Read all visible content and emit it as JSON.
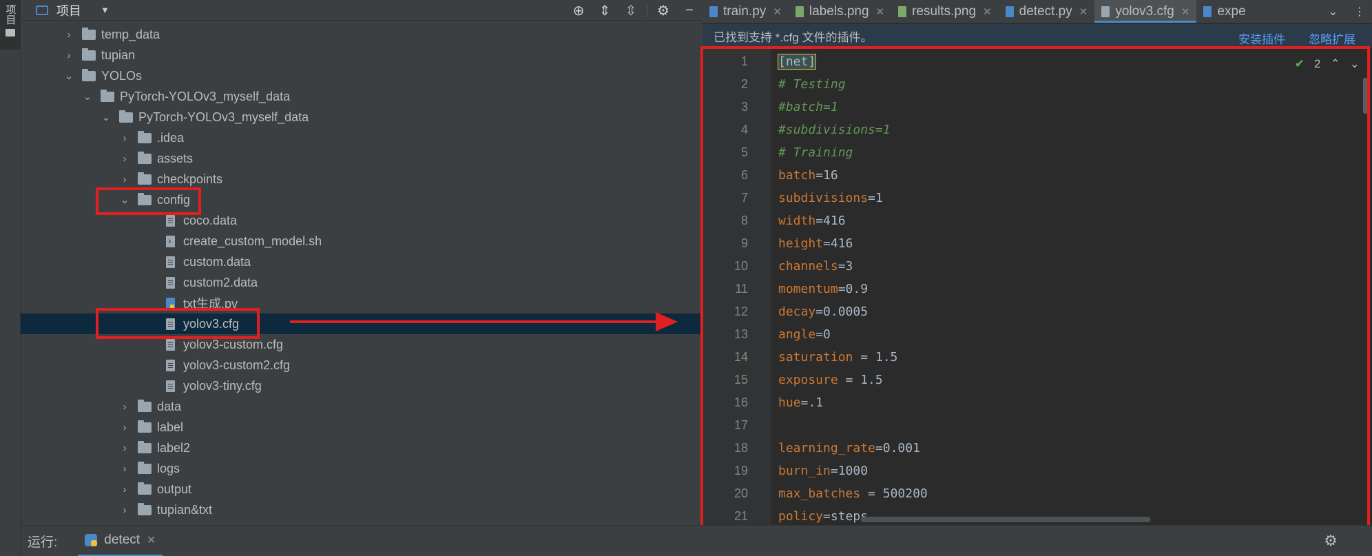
{
  "sidebar": {
    "project_tab_label": "项目"
  },
  "project_panel": {
    "title": "项目",
    "tree": [
      {
        "label": "temp_data",
        "type": "folder",
        "expanded": false
      },
      {
        "label": "tupian",
        "type": "folder",
        "expanded": false
      },
      {
        "label": "YOLOs",
        "type": "folder",
        "expanded": true
      },
      {
        "label": "PyTorch-YOLOv3_myself_data",
        "type": "folder",
        "expanded": true
      },
      {
        "label": "PyTorch-YOLOv3_myself_data",
        "type": "folder",
        "expanded": true
      },
      {
        "label": ".idea",
        "type": "folder",
        "expanded": false
      },
      {
        "label": "assets",
        "type": "folder",
        "expanded": false
      },
      {
        "label": "checkpoints",
        "type": "folder",
        "expanded": false
      },
      {
        "label": "config",
        "type": "folder",
        "expanded": true
      },
      {
        "label": "coco.data",
        "type": "file"
      },
      {
        "label": "create_custom_model.sh",
        "type": "shell"
      },
      {
        "label": "custom.data",
        "type": "file"
      },
      {
        "label": "custom2.data",
        "type": "file"
      },
      {
        "label": "txt生成.py",
        "type": "py"
      },
      {
        "label": "yolov3.cfg",
        "type": "file",
        "selected": true
      },
      {
        "label": "yolov3-custom.cfg",
        "type": "file"
      },
      {
        "label": "yolov3-custom2.cfg",
        "type": "file"
      },
      {
        "label": "yolov3-tiny.cfg",
        "type": "file"
      },
      {
        "label": "data",
        "type": "folder",
        "expanded": false
      },
      {
        "label": "label",
        "type": "folder",
        "expanded": false
      },
      {
        "label": "label2",
        "type": "folder",
        "expanded": false
      },
      {
        "label": "logs",
        "type": "folder",
        "expanded": false
      },
      {
        "label": "output",
        "type": "folder",
        "expanded": false
      },
      {
        "label": "tupian&txt",
        "type": "folder",
        "expanded": false
      }
    ]
  },
  "editor": {
    "tabs": [
      {
        "label": "train.py",
        "icon": "python-file-icon",
        "active": false
      },
      {
        "label": "labels.png",
        "icon": "image-file-icon",
        "active": false
      },
      {
        "label": "results.png",
        "icon": "image-file-icon",
        "active": false
      },
      {
        "label": "detect.py",
        "icon": "python-file-icon",
        "active": false
      },
      {
        "label": "yolov3.cfg",
        "icon": "text-file-icon",
        "active": true
      },
      {
        "label": "expe",
        "icon": "python-file-icon",
        "active": false
      }
    ],
    "plugin_bar": {
      "message": "已找到支持 *.cfg 文件的插件。",
      "install_link": "安装插件",
      "ignore_link": "忽略扩展"
    },
    "inspection_count": "2",
    "lines": [
      {
        "n": "1",
        "parts": [
          [
            "brk",
            "[net]"
          ]
        ]
      },
      {
        "n": "2",
        "parts": [
          [
            "cmt",
            "# Testing"
          ]
        ]
      },
      {
        "n": "3",
        "parts": [
          [
            "cmt",
            "#batch=1"
          ]
        ]
      },
      {
        "n": "4",
        "parts": [
          [
            "cmt",
            "#subdivisions=1"
          ]
        ]
      },
      {
        "n": "5",
        "parts": [
          [
            "cmt",
            "# Training"
          ]
        ]
      },
      {
        "n": "6",
        "parts": [
          [
            "key",
            "batch"
          ],
          [
            "val",
            "=16"
          ]
        ]
      },
      {
        "n": "7",
        "parts": [
          [
            "key",
            "subdivisions"
          ],
          [
            "val",
            "=1"
          ]
        ]
      },
      {
        "n": "8",
        "parts": [
          [
            "key",
            "width"
          ],
          [
            "val",
            "=416"
          ]
        ]
      },
      {
        "n": "9",
        "parts": [
          [
            "key",
            "height"
          ],
          [
            "val",
            "=416"
          ]
        ]
      },
      {
        "n": "10",
        "parts": [
          [
            "key",
            "channels"
          ],
          [
            "val",
            "=3"
          ]
        ]
      },
      {
        "n": "11",
        "parts": [
          [
            "key",
            "momentum"
          ],
          [
            "val",
            "=0.9"
          ]
        ]
      },
      {
        "n": "12",
        "parts": [
          [
            "key",
            "decay"
          ],
          [
            "val",
            "=0.0005"
          ]
        ]
      },
      {
        "n": "13",
        "parts": [
          [
            "key",
            "angle"
          ],
          [
            "val",
            "=0"
          ]
        ]
      },
      {
        "n": "14",
        "parts": [
          [
            "key",
            "saturation"
          ],
          [
            "val",
            " = 1.5"
          ]
        ]
      },
      {
        "n": "15",
        "parts": [
          [
            "key",
            "exposure"
          ],
          [
            "val",
            " = 1.5"
          ]
        ]
      },
      {
        "n": "16",
        "parts": [
          [
            "key",
            "hue"
          ],
          [
            "val",
            "=.1"
          ]
        ]
      },
      {
        "n": "17",
        "parts": []
      },
      {
        "n": "18",
        "parts": [
          [
            "key",
            "learning_rate"
          ],
          [
            "val",
            "=0.001"
          ]
        ]
      },
      {
        "n": "19",
        "parts": [
          [
            "key",
            "burn_in"
          ],
          [
            "val",
            "=1000"
          ]
        ]
      },
      {
        "n": "20",
        "parts": [
          [
            "key",
            "max_batches"
          ],
          [
            "val",
            " = 500200"
          ]
        ]
      },
      {
        "n": "21",
        "parts": [
          [
            "key",
            "policy"
          ],
          [
            "val",
            "=steps"
          ]
        ]
      }
    ]
  },
  "run_bar": {
    "label": "运行:",
    "tab": "detect"
  },
  "colors": {
    "accent": "#4a88c7",
    "annotation_red": "#e02020",
    "selection": "#0d293e",
    "keyword": "#cc7832",
    "comment": "#629755"
  }
}
